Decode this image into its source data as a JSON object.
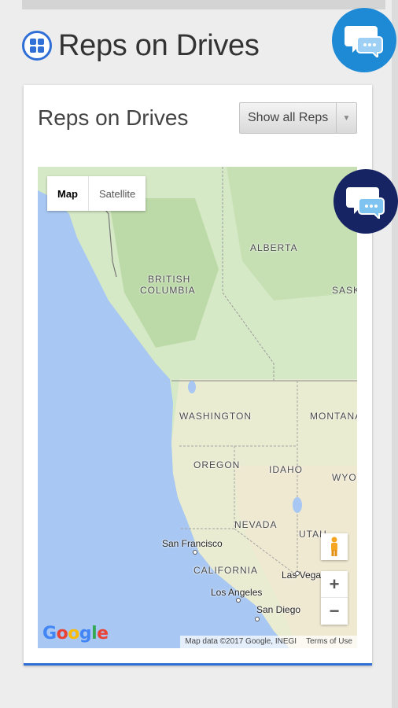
{
  "page": {
    "title": "Reps on Drives"
  },
  "card": {
    "title": "Reps on Drives",
    "select": {
      "selected": "Show all Reps"
    }
  },
  "map": {
    "type_buttons": [
      "Map",
      "Satellite"
    ],
    "region_labels": [
      {
        "name": "ALBERTA"
      },
      {
        "name": "BRITISH"
      },
      {
        "name": "COLUMBIA"
      },
      {
        "name": "SASK"
      },
      {
        "name": "WASHINGTON"
      },
      {
        "name": "MONTANA"
      },
      {
        "name": "OREGON"
      },
      {
        "name": "IDAHO"
      },
      {
        "name": "WYO"
      },
      {
        "name": "NEVADA"
      },
      {
        "name": "UTAH"
      },
      {
        "name": "CALIFORNIA"
      }
    ],
    "cities": [
      {
        "name": "San Francisco"
      },
      {
        "name": "Las Vegas"
      },
      {
        "name": "Los Angeles"
      },
      {
        "name": "San Diego"
      }
    ],
    "zoom_in": "+",
    "zoom_out": "−",
    "logo": "Google",
    "attribution": "Map data ©2017 Google, INEGI",
    "terms": "Terms of Use"
  },
  "icons": {
    "header": "grid-circle-icon",
    "chat": "chat-bubble-icon",
    "pegman": "pegman-icon"
  },
  "colors": {
    "accent": "#2f6fd6",
    "chat_light": "#1e8ad6",
    "chat_dark": "#162463",
    "water": "#a8c7f2",
    "land_green": "#cfe6c0",
    "land_tan": "#f0e9d2"
  }
}
